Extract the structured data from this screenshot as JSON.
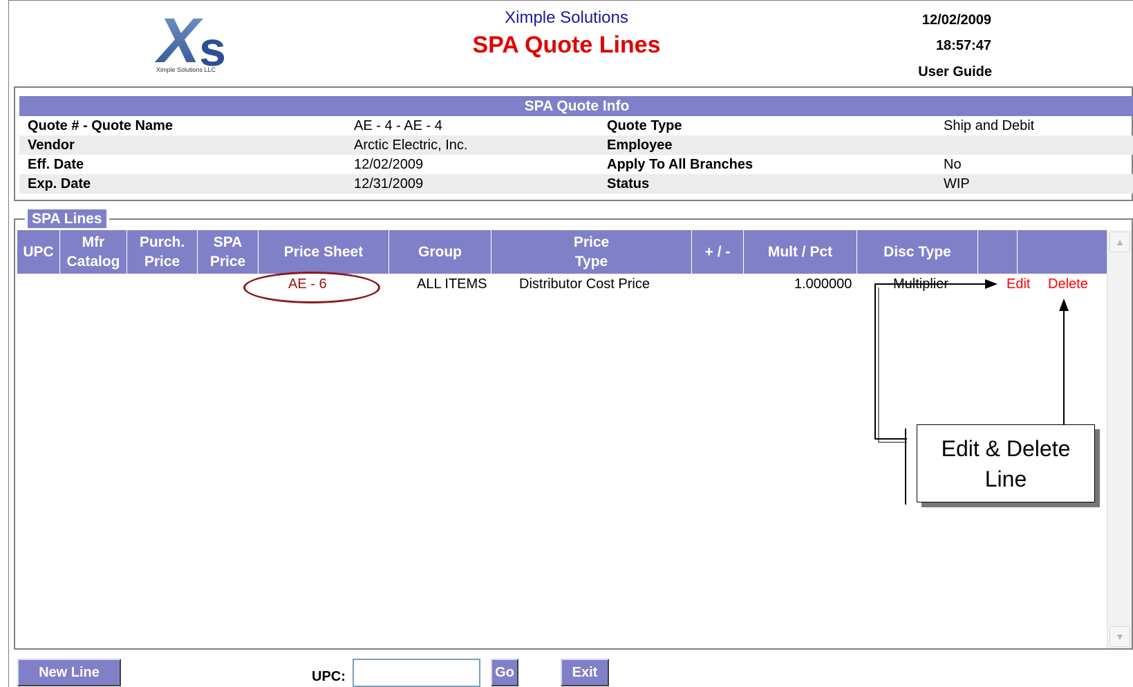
{
  "header": {
    "logo_text": "Ximple Solutions LLC",
    "company": "Ximple Solutions",
    "title": "SPA Quote Lines",
    "date": "12/02/2009",
    "time": "18:57:47",
    "user_guide": "User Guide"
  },
  "quote_info": {
    "title": "SPA Quote Info",
    "rows": [
      {
        "label1": "Quote # - Quote Name",
        "value1": "AE - 4 - AE - 4",
        "label2": "Quote Type",
        "value2": "Ship and Debit"
      },
      {
        "label1": "Vendor",
        "value1": "Arctic Electric, Inc.",
        "label2": "Employee",
        "value2": ""
      },
      {
        "label1": "Eff. Date",
        "value1": "12/02/2009",
        "label2": "Apply To All Branches",
        "value2": "No"
      },
      {
        "label1": "Exp. Date",
        "value1": "12/31/2009",
        "label2": "Status",
        "value2": "WIP"
      }
    ]
  },
  "lines": {
    "legend": "SPA Lines",
    "columns": {
      "upc": "UPC",
      "mfr1": "Mfr",
      "mfr2": "Catalog",
      "purch1": "Purch.",
      "purch2": "Price",
      "spa1": "SPA",
      "spa2": "Price",
      "price_sheet": "Price Sheet",
      "group": "Group",
      "ptype1": "Price",
      "ptype2": "Type",
      "plus_minus": "+ / -",
      "mult_pct": "Mult / Pct",
      "disc_type": "Disc Type"
    },
    "rows": [
      {
        "price_sheet": "AE - 6",
        "group": "ALL ITEMS",
        "price_type": "Distributor Cost Price",
        "mult_pct": "1.000000",
        "disc_type": "Multiplier",
        "edit": "Edit",
        "delete": "Delete"
      }
    ]
  },
  "callout": {
    "line1": "Edit & Delete",
    "line2": "Line"
  },
  "footer": {
    "new_line": "New Line",
    "upc_label": "UPC:",
    "upc_value": "",
    "go": "Go",
    "exit": "Exit"
  },
  "colors": {
    "accent": "#8080c8",
    "title_red": "#e10000",
    "link_red": "#ff0000"
  }
}
